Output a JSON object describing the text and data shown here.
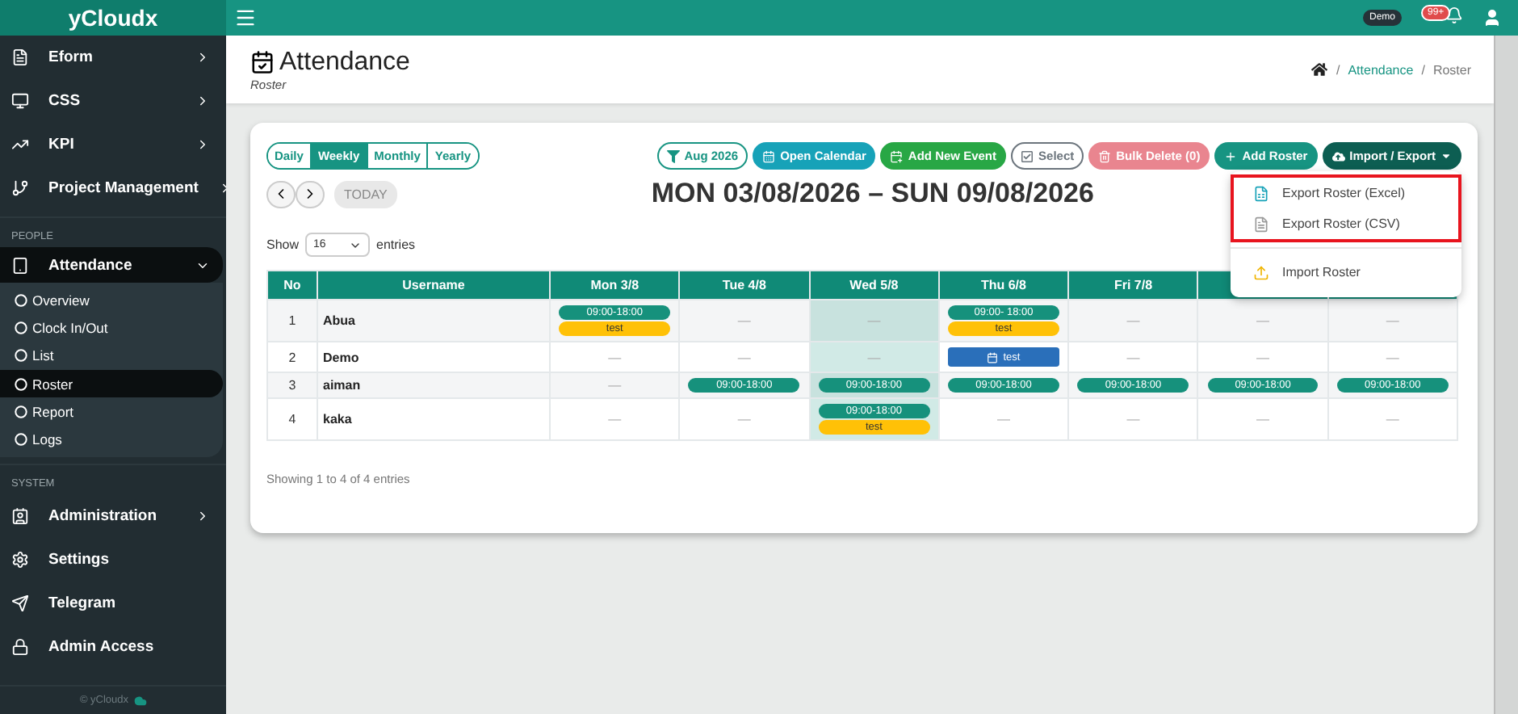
{
  "brand": "yCloudx",
  "topbar": {
    "user_badge": "Demo",
    "notification_count": "99+"
  },
  "sidebar": {
    "groups": [
      {
        "items": [
          {
            "label": "Eform",
            "expanded": false,
            "selected": false
          },
          {
            "label": "CSS",
            "expanded": false,
            "selected": false
          },
          {
            "label": "KPI",
            "expanded": false,
            "selected": false
          },
          {
            "label": "Project Management",
            "expanded": false,
            "selected": false
          }
        ]
      },
      {
        "heading": "PEOPLE",
        "items": [
          {
            "label": "Attendance",
            "expanded": true,
            "selected": true,
            "children": [
              {
                "label": "Overview",
                "selected": false
              },
              {
                "label": "Clock In/Out",
                "selected": false
              },
              {
                "label": "List",
                "selected": false
              },
              {
                "label": "Roster",
                "selected": true
              },
              {
                "label": "Report",
                "selected": false
              },
              {
                "label": "Logs",
                "selected": false
              }
            ]
          }
        ]
      },
      {
        "heading": "SYSTEM",
        "items": [
          {
            "label": "Administration",
            "expanded": false,
            "selected": false
          },
          {
            "label": "Settings",
            "selected": false
          },
          {
            "label": "Telegram",
            "selected": false
          },
          {
            "label": "Admin Access",
            "selected": false
          }
        ]
      }
    ],
    "footer": "© yCloudx"
  },
  "page": {
    "title": "Attendance",
    "subtitle": "Roster",
    "breadcrumb_separator": "/",
    "breadcrumb": [
      {
        "label": "Attendance",
        "current": false
      },
      {
        "label": "Roster",
        "current": true
      }
    ]
  },
  "toolbar": {
    "view_tabs": [
      {
        "label": "Daily",
        "selected": false
      },
      {
        "label": "Weekly",
        "selected": true
      },
      {
        "label": "Monthly",
        "selected": false
      },
      {
        "label": "Yearly",
        "selected": false
      }
    ],
    "buttons": [
      {
        "label": "Aug 2026",
        "kind": "filter",
        "disabled": false
      },
      {
        "label": "Open Calendar",
        "kind": "calendar",
        "disabled": false
      },
      {
        "label": "Add New Event",
        "kind": "event",
        "disabled": false
      },
      {
        "label": "Select",
        "kind": "select",
        "disabled": false
      },
      {
        "label": "Bulk Delete (0)",
        "kind": "delete",
        "disabled": true
      },
      {
        "label": "Add Roster",
        "kind": "add",
        "disabled": false
      },
      {
        "label": "Import / Export",
        "kind": "menu",
        "disabled": false
      }
    ]
  },
  "navigation": {
    "today_button": {
      "label": "TODAY",
      "disabled": true
    },
    "range": "MON 03/08/2026 – SUN 09/08/2026"
  },
  "entries": {
    "prefix": "Show",
    "value": "16",
    "suffix": "entries"
  },
  "table": {
    "columns": [
      {
        "label": "No",
        "today": false
      },
      {
        "label": "Username",
        "today": false
      },
      {
        "label": "Mon 3/8",
        "today": false
      },
      {
        "label": "Tue 4/8",
        "today": false
      },
      {
        "label": "Wed 5/8",
        "today": true
      },
      {
        "label": "Thu 6/8",
        "today": false
      },
      {
        "label": "Fri 7/8",
        "today": false
      },
      {
        "today": false
      },
      {
        "today": false
      }
    ],
    "rows": [
      {
        "cells": [
          {
            "text": "1"
          },
          {
            "text": "Abua"
          },
          {
            "events": [
              {
                "kind": "shift",
                "text": "09:00-18:00"
              },
              {
                "kind": "tag",
                "text": "test"
              }
            ]
          },
          {
            "text": "—"
          },
          {
            "text": "—"
          },
          {
            "events": [
              {
                "kind": "shift",
                "text": "09:00- 18:00"
              },
              {
                "kind": "tag",
                "text": "test"
              }
            ]
          },
          {
            "text": "—"
          },
          {
            "text": "—"
          },
          {
            "text": "—"
          }
        ]
      },
      {
        "cells": [
          {
            "text": "2"
          },
          {
            "text": "Demo"
          },
          {
            "text": "—"
          },
          {
            "text": "—"
          },
          {
            "text": "—"
          },
          {
            "events": [
              {
                "kind": "event",
                "text": "test"
              }
            ]
          },
          {
            "text": "—"
          },
          {
            "text": "—"
          },
          {
            "text": "—"
          }
        ]
      },
      {
        "cells": [
          {
            "text": "3"
          },
          {
            "text": "aiman"
          },
          {
            "text": "—"
          },
          {
            "events": [
              {
                "kind": "shift",
                "text": "09:00-18:00"
              }
            ]
          },
          {
            "events": [
              {
                "kind": "shift",
                "text": "09:00-18:00"
              }
            ]
          },
          {
            "events": [
              {
                "kind": "shift",
                "text": "09:00-18:00"
              }
            ]
          },
          {
            "events": [
              {
                "kind": "shift",
                "text": "09:00-18:00"
              }
            ]
          },
          {
            "events": [
              {
                "kind": "shift",
                "text": "09:00-18:00"
              }
            ]
          },
          {
            "events": [
              {
                "kind": "shift",
                "text": "09:00-18:00"
              }
            ]
          }
        ]
      },
      {
        "cells": [
          {
            "text": "4"
          },
          {
            "text": "kaka"
          },
          {
            "text": "—"
          },
          {
            "text": "—"
          },
          {
            "events": [
              {
                "kind": "shift",
                "text": "09:00-18:00"
              },
              {
                "kind": "tag",
                "text": "test"
              }
            ]
          },
          {
            "text": "—"
          },
          {
            "text": "—"
          },
          {
            "text": "—"
          },
          {
            "text": "—"
          }
        ]
      }
    ],
    "info": "Showing 1 to 4 of 4 entries"
  },
  "dropdown": {
    "sections": [
      {
        "highlighted": true,
        "items": [
          {
            "label": "Export Roster (Excel)",
            "kind": "excel"
          },
          {
            "label": "Export Roster (CSV)",
            "kind": "csv"
          }
        ]
      },
      {
        "highlighted": false,
        "items": [
          {
            "label": "Import Roster",
            "kind": "import"
          }
        ]
      }
    ]
  }
}
